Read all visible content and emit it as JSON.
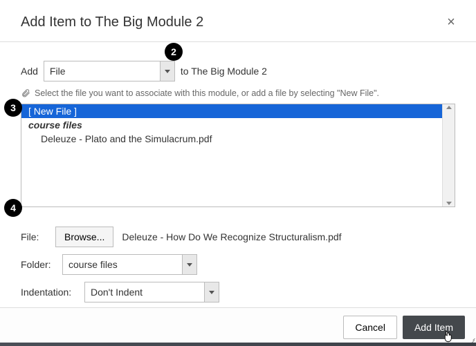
{
  "title": "Add Item to The Big Module 2",
  "add_row": {
    "prefix": "Add",
    "type_value": "File",
    "suffix": "to The Big Module 2"
  },
  "hint": "Select the file you want to associate with this module, or add a file by selecting \"New File\".",
  "file_list": {
    "new_file_label": "[ New File ]",
    "group_label": "course files",
    "file1": "Deleuze - Plato and the Simulacrum.pdf"
  },
  "file_row": {
    "label": "File:",
    "browse": "Browse...",
    "chosen": "Deleuze - How Do We Recognize Structuralism.pdf"
  },
  "folder_row": {
    "label": "Folder:",
    "value": "course files"
  },
  "indent_row": {
    "label": "Indentation:",
    "value": "Don't Indent"
  },
  "footer": {
    "cancel": "Cancel",
    "add": "Add Item"
  },
  "callouts": {
    "c2": "2",
    "c3": "3",
    "c4": "4"
  }
}
